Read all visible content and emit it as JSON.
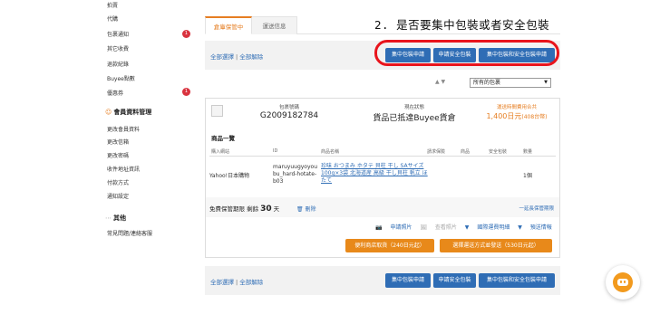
{
  "sidebar": {
    "items": [
      {
        "label": "拍賣"
      },
      {
        "label": "代購"
      },
      {
        "label": "包裹通知",
        "badge": "1"
      },
      {
        "label": "其它收費"
      },
      {
        "label": "退款紀錄"
      },
      {
        "label": "Buyee點數"
      },
      {
        "label": "優惠券",
        "badge": "1"
      }
    ],
    "section_member": "會員資料管理",
    "member_items": [
      {
        "label": "更改會員資料"
      },
      {
        "label": "更改信箱"
      },
      {
        "label": "更改密碼"
      },
      {
        "label": "收件地址資訊"
      },
      {
        "label": "付款方式"
      },
      {
        "label": "通知設定"
      }
    ],
    "section_other": "其他",
    "other_items": [
      {
        "label": "常見問題/連絡客服"
      }
    ]
  },
  "tabs": [
    {
      "label": "倉庫保管中"
    },
    {
      "label": "運送信息"
    }
  ],
  "annotation": "2. 是否要集中包裝或者安全包裝",
  "toolbar": {
    "select_all": "全部選擇",
    "separator": "|",
    "deselect_all": "全部解除",
    "buttons": [
      "集中包裝申請",
      "申請安全包裝",
      "集中包裝和安全包裝申請"
    ]
  },
  "sort": {
    "arrows": "▲ ▼",
    "selected": "所有的包裹"
  },
  "package": {
    "number_label": "包裹號碼",
    "number": "G2009182784",
    "status_label": "現在狀態",
    "status": "貨品已抵達Buyee貨倉",
    "fee_label": "運送時間費用合共",
    "fee": "1,400日元",
    "fee_note": "(408台幣)"
  },
  "items": {
    "title": "商品一覽",
    "headers": [
      "購入網站",
      "ID",
      "商品名稱",
      "請求保險",
      "商品",
      "安全包裝",
      "數量"
    ],
    "row": {
      "site": "Yahoo!日本購物",
      "id_lines": [
        "maruyuugyoyou",
        "bu_hard-hotate-",
        "b03"
      ],
      "name": "珍味 おつまみ ホタテ 貝柱 干し SAサイズ 100g×3袋 北海道産 高級 干し貝柱 帆立 ほたて",
      "qty": "1個"
    }
  },
  "storage": {
    "label": "免費保管期限",
    "remaining_label": "剩餘",
    "days": "30",
    "days_unit": "天",
    "delete": "刪除",
    "extend": "一延長保管期限"
  },
  "actions": {
    "photo": "申請照片",
    "view_photo": "查看照片",
    "intl_shipping": "國際運費明細",
    "preview": "預送情報"
  },
  "orange_buttons": [
    "便利商店取貨（240日元起）",
    "選擇運送方式並發送（530日元起）"
  ],
  "colors": {
    "accent_orange": "#e67e22",
    "button_blue": "#2f6db5",
    "highlight_red": "#e8141c"
  }
}
